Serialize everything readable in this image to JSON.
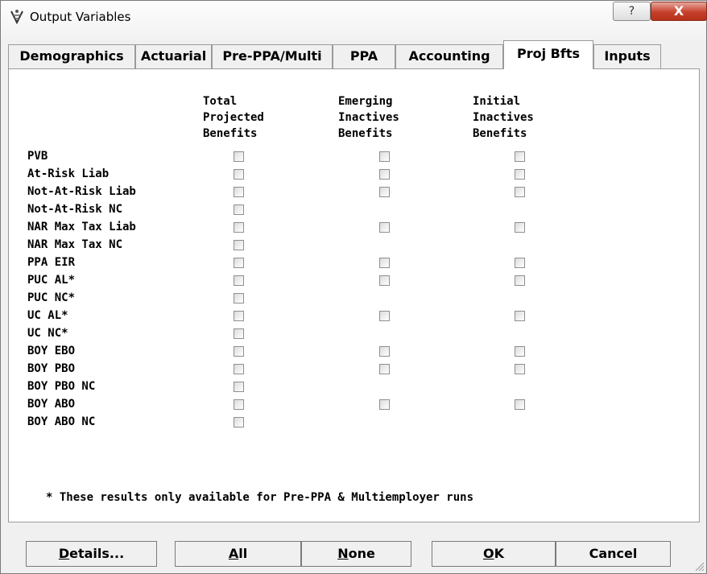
{
  "window": {
    "title": "Output Variables",
    "help_label": "?",
    "close_label": "X"
  },
  "tabs": [
    {
      "label": "Demographics"
    },
    {
      "label": "Actuarial"
    },
    {
      "label": "Pre-PPA/Multi"
    },
    {
      "label": "PPA"
    },
    {
      "label": "Accounting"
    },
    {
      "label": "Proj Bfts",
      "active": true
    },
    {
      "label": "Inputs"
    }
  ],
  "columns": [
    {
      "header": "Total\nProjected\nBenefits"
    },
    {
      "header": "Emerging\nInactives\nBenefits"
    },
    {
      "header": "Initial\nInactives\nBenefits"
    }
  ],
  "rows": [
    {
      "label": "PVB",
      "boxes": [
        true,
        true,
        true
      ]
    },
    {
      "label": "At-Risk Liab",
      "boxes": [
        true,
        true,
        true
      ]
    },
    {
      "label": "Not-At-Risk Liab",
      "boxes": [
        true,
        true,
        true
      ]
    },
    {
      "label": "Not-At-Risk NC",
      "boxes": [
        true,
        false,
        false
      ]
    },
    {
      "label": "NAR Max Tax Liab",
      "boxes": [
        true,
        true,
        true
      ]
    },
    {
      "label": "NAR Max Tax NC",
      "boxes": [
        true,
        false,
        false
      ]
    },
    {
      "label": "PPA EIR",
      "boxes": [
        true,
        true,
        true
      ]
    },
    {
      "label": "PUC AL*",
      "boxes": [
        true,
        true,
        true
      ]
    },
    {
      "label": "PUC NC*",
      "boxes": [
        true,
        false,
        false
      ]
    },
    {
      "label": "UC AL*",
      "boxes": [
        true,
        true,
        true
      ]
    },
    {
      "label": "UC NC*",
      "boxes": [
        true,
        false,
        false
      ]
    },
    {
      "label": "BOY EBO",
      "boxes": [
        true,
        true,
        true
      ]
    },
    {
      "label": "BOY PBO",
      "boxes": [
        true,
        true,
        true
      ]
    },
    {
      "label": "BOY PBO NC",
      "boxes": [
        true,
        false,
        false
      ]
    },
    {
      "label": "BOY ABO",
      "boxes": [
        true,
        true,
        true
      ]
    },
    {
      "label": "BOY ABO NC",
      "boxes": [
        true,
        false,
        false
      ]
    }
  ],
  "footnote": "* These results only available for Pre-PPA & Multiemployer runs",
  "buttons": {
    "details": {
      "mnemonic": "D",
      "rest": "etails..."
    },
    "all": {
      "mnemonic": "A",
      "rest": "ll"
    },
    "none": {
      "mnemonic": "N",
      "rest": "one"
    },
    "ok": {
      "mnemonic": "O",
      "rest": "K"
    },
    "cancel": {
      "label": "Cancel"
    }
  }
}
